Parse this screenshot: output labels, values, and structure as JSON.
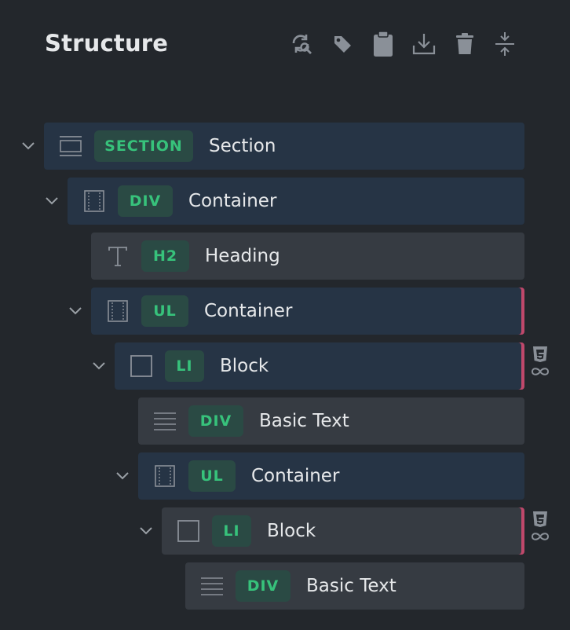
{
  "panel": {
    "title": "Structure",
    "toolbar": [
      {
        "icon": "sync-search-icon"
      },
      {
        "icon": "tag-icon"
      },
      {
        "icon": "clipboard-icon"
      },
      {
        "icon": "download-icon"
      },
      {
        "icon": "trash-icon"
      },
      {
        "icon": "collapse-icon"
      }
    ]
  },
  "tree": [
    {
      "tag": "SECTION",
      "label": "Section",
      "icon": "section-icon",
      "expanded": true
    },
    {
      "tag": "DIV",
      "label": "Container",
      "icon": "container-icon",
      "expanded": true
    },
    {
      "tag": "H2",
      "label": "Heading",
      "icon": "text-icon"
    },
    {
      "tag": "UL",
      "label": "Container",
      "icon": "container-icon",
      "expanded": true
    },
    {
      "tag": "LI",
      "label": "Block",
      "icon": "block-icon",
      "expanded": true,
      "badges": [
        "css3-icon",
        "infinity-icon"
      ]
    },
    {
      "tag": "DIV",
      "label": "Basic Text",
      "icon": "paragraph-icon"
    },
    {
      "tag": "UL",
      "label": "Container",
      "icon": "container-icon",
      "expanded": true
    },
    {
      "tag": "LI",
      "label": "Block",
      "icon": "block-icon",
      "expanded": true,
      "badges": [
        "css3-icon",
        "infinity-icon"
      ]
    },
    {
      "tag": "DIV",
      "label": "Basic Text",
      "icon": "paragraph-icon"
    }
  ],
  "colors": {
    "background": "#23272c",
    "row_dark": "#263445",
    "row_gray": "#363b42",
    "tag_bg": "#2a4a44",
    "tag_text": "#37c27b",
    "marker": "#c0486b"
  }
}
